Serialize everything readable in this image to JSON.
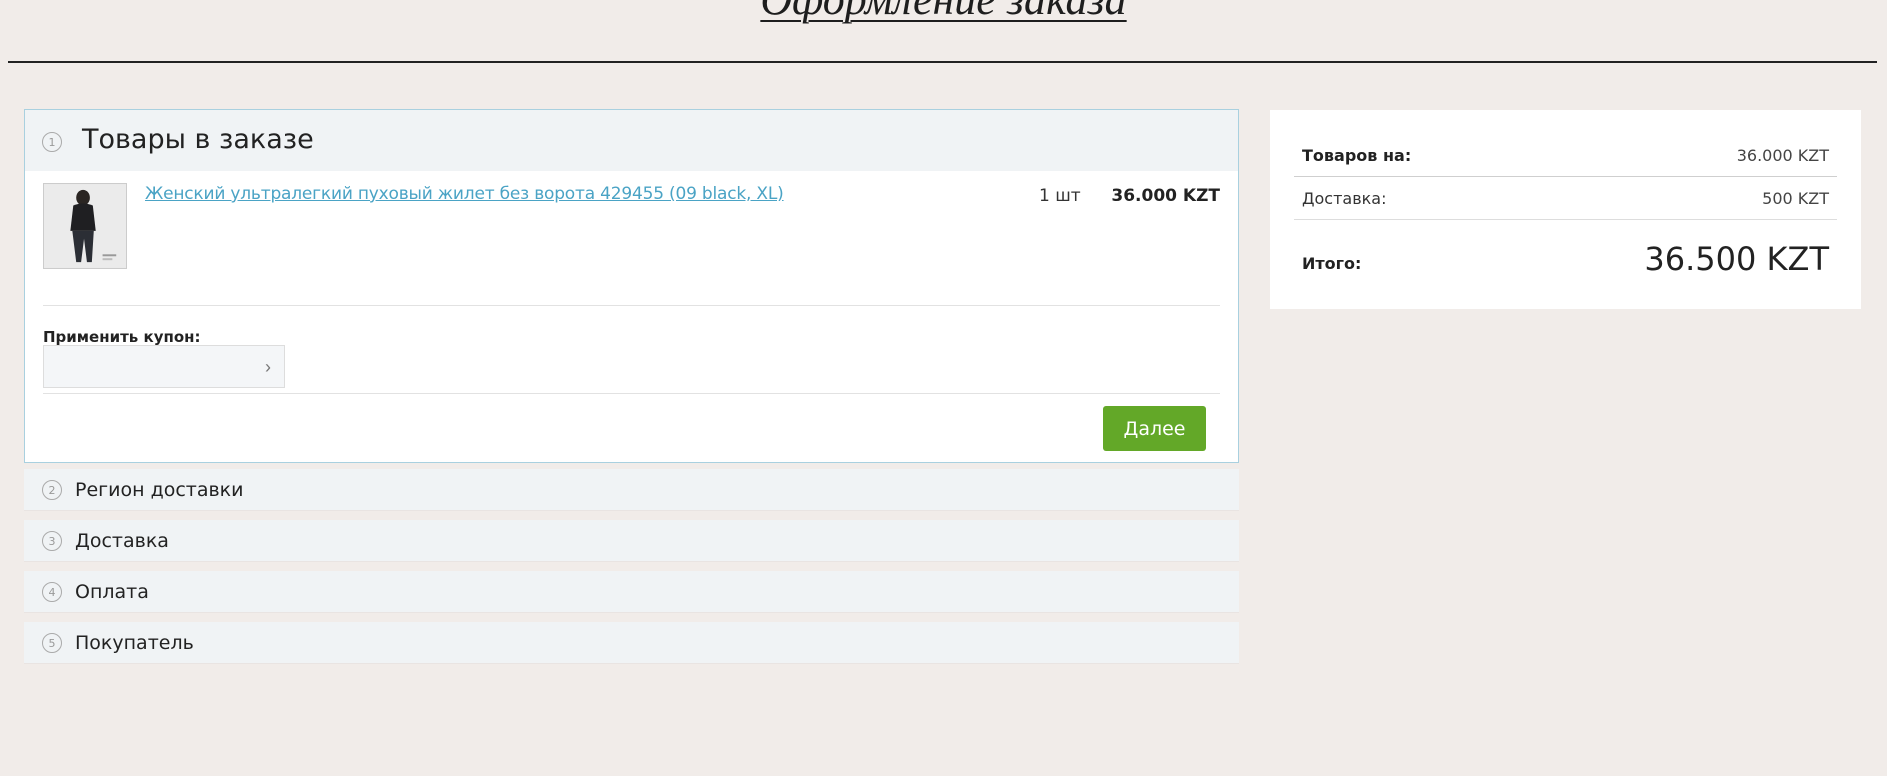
{
  "header": {
    "title": "Оформление заказа"
  },
  "steps": {
    "cart": {
      "number": "1",
      "title": "Товары в заказе",
      "item": {
        "name": "Женский ультралегкий пуховый жилет без ворота 429455 (09 black, XL)",
        "quantity": "1 шт",
        "price": "36.000 KZT"
      },
      "coupon_label": "Применить купон:",
      "coupon_value": "",
      "next_label": "Далее"
    },
    "collapsed": [
      {
        "number": "2",
        "title": "Регион доставки"
      },
      {
        "number": "3",
        "title": "Доставка"
      },
      {
        "number": "4",
        "title": "Оплата"
      },
      {
        "number": "5",
        "title": "Покупатель"
      }
    ]
  },
  "summary": {
    "goods_label": "Товаров на:",
    "goods_value": "36.000 KZT",
    "delivery_label": "Доставка:",
    "delivery_value": "500 KZT",
    "total_label": "Итого:",
    "total_value": "36.500 KZT"
  },
  "colors": {
    "accent_button": "#63a828",
    "link": "#4aa3c5",
    "background": "#f1ece9"
  },
  "icons": {
    "coupon_submit": "chevron-right-icon"
  }
}
